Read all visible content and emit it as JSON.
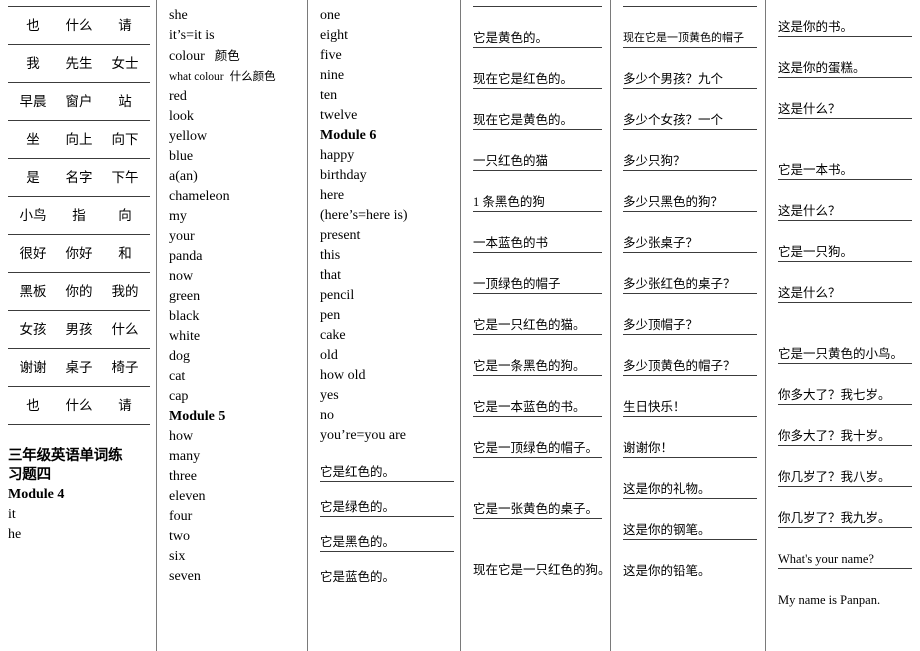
{
  "document": {
    "title_line1": "三年级英语单词练",
    "title_line2": "习题四",
    "module4_label": "Module 4"
  },
  "column1": {
    "name": "chinese-word-grid",
    "rows": [
      [
        "也",
        "什么",
        "请"
      ],
      [
        "我",
        "先生",
        "女士"
      ],
      [
        "早晨",
        "窗户",
        "站"
      ],
      [
        "坐",
        "向上",
        "向下"
      ],
      [
        "是",
        "名字",
        "下午"
      ],
      [
        "小鸟",
        "指",
        "向"
      ],
      [
        "很好",
        "你好",
        "和"
      ],
      [
        "黑板",
        "你的",
        "我的"
      ],
      [
        "女孩",
        "男孩",
        "什么"
      ],
      [
        "谢谢",
        "桌子",
        "椅子"
      ],
      [
        "也",
        "什么",
        "请"
      ]
    ],
    "words_after_module4": [
      "it",
      "he"
    ]
  },
  "column2": {
    "name": "word-list-module4-5",
    "items": [
      {
        "en": "she"
      },
      {
        "en": "it’s=it is"
      },
      {
        "en": "colour",
        "cn": "颜色"
      },
      {
        "en": "what colour",
        "cn": "什么颜色",
        "small": true
      },
      {
        "en": "red"
      },
      {
        "en": "look"
      },
      {
        "en": "yellow"
      },
      {
        "en": "blue"
      },
      {
        "en": "a(an)"
      },
      {
        "en": "chameleon"
      },
      {
        "en": "my"
      },
      {
        "en": "your"
      },
      {
        "en": "panda"
      },
      {
        "en": "now"
      },
      {
        "en": "green"
      },
      {
        "en": "black"
      },
      {
        "en": "white"
      },
      {
        "en": "dog"
      },
      {
        "en": "cat"
      },
      {
        "en": "cap"
      },
      {
        "en": "Module 5",
        "bold": true
      },
      {
        "en": "how"
      },
      {
        "en": "many"
      },
      {
        "en": "three"
      },
      {
        "en": "eleven"
      },
      {
        "en": "four"
      },
      {
        "en": "two"
      },
      {
        "en": "six"
      },
      {
        "en": "seven"
      }
    ]
  },
  "column3": {
    "name": "word-list-module5-6",
    "items": [
      {
        "en": "one"
      },
      {
        "en": "eight"
      },
      {
        "en": "five"
      },
      {
        "en": "nine"
      },
      {
        "en": "ten"
      },
      {
        "en": "twelve"
      },
      {
        "en": "Module 6",
        "bold": true
      },
      {
        "en": "happy"
      },
      {
        "en": "birthday"
      },
      {
        "en": "here"
      },
      {
        "en": "(here’s=here is)"
      },
      {
        "en": "present"
      },
      {
        "en": "this"
      },
      {
        "en": "that"
      },
      {
        "en": "pencil"
      },
      {
        "en": "pen"
      },
      {
        "en": "cake"
      },
      {
        "en": "old"
      },
      {
        "en": "how old"
      },
      {
        "en": "yes"
      },
      {
        "en": "no"
      },
      {
        "en": "you’re=you are"
      }
    ],
    "translation_rows": [
      {
        "cn": "它是红色的。",
        "rule_above": false
      },
      {
        "cn": "它是绿色的。",
        "rule_above": true
      },
      {
        "cn": "它是黑色的。",
        "rule_above": true
      },
      {
        "cn": "它是蓝色的。",
        "rule_above": true
      }
    ]
  },
  "column4": {
    "name": "translation-practice-column-4",
    "rows": [
      {
        "cn": "它是黄色的。"
      },
      {
        "cn": "现在它是红色的。"
      },
      {
        "cn": "现在它是黄色的。"
      },
      {
        "cn": "一只红色的猫"
      },
      {
        "cn": "1 条黑色的狗"
      },
      {
        "cn": "一本蓝色的书"
      },
      {
        "cn": "一顶绿色的帽子"
      },
      {
        "cn": "它是一只红色的猫。"
      },
      {
        "cn": "它是一条黑色的狗。"
      },
      {
        "cn": "它是一本蓝色的书。"
      },
      {
        "cn": "它是一顶绿色的帽子。"
      },
      {
        "cn": "它是一张黄色的桌子。",
        "tall": true
      },
      {
        "cn": "现在它是一只红色的狗。",
        "tall": true
      }
    ]
  },
  "column5": {
    "name": "translation-practice-column-5",
    "rows": [
      {
        "cn": "现在它是一顶黄色的帽子",
        "small": true
      },
      {
        "cn": "多少个男孩？九个"
      },
      {
        "cn": "多少个女孩？一个"
      },
      {
        "cn": "多少只狗？"
      },
      {
        "cn": "多少只黑色的狗？"
      },
      {
        "cn": "多少张桌子？"
      },
      {
        "cn": "多少张红色的桌子？"
      },
      {
        "cn": "多少顶帽子？"
      },
      {
        "cn": "多少顶黄色的帽子？"
      },
      {
        "cn": "生日快乐！"
      },
      {
        "cn": "谢谢你！"
      },
      {
        "cn": "这是你的礼物。"
      },
      {
        "cn": "这是你的钢笔。"
      },
      {
        "cn": "这是你的铅笔。"
      }
    ]
  },
  "column6": {
    "name": "translation-practice-column-6",
    "rows": [
      {
        "cn": "这是你的书。",
        "first": true
      },
      {
        "cn": "这是你的蛋糕。"
      },
      {
        "cn": "这是什么？"
      },
      {
        "cn": "它是一本书。",
        "tall": true
      },
      {
        "cn": "这是什么？"
      },
      {
        "cn": "它是一只狗。"
      },
      {
        "cn": "这是什么？"
      },
      {
        "cn": "它是一只黄色的小鸟。",
        "tall": true
      },
      {
        "cn": "你多大了？我七岁。"
      },
      {
        "cn": "你多大了？我十岁。"
      },
      {
        "cn": "你几岁了？我八岁。"
      },
      {
        "cn": "你几岁了？我九岁。"
      },
      {
        "cn": "What's your name?"
      },
      {
        "cn": "My name is Panpan."
      }
    ]
  }
}
